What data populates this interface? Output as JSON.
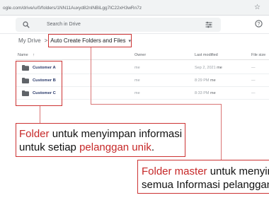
{
  "browser": {
    "url": "ogle.com/drive/u/0/folders/1NN11Auxyd82nlNBiLgg7lC22xH3wRn7z"
  },
  "search": {
    "placeholder": "Search in Drive"
  },
  "breadcrumb": {
    "root": "My Drive",
    "separator": ">",
    "current": "Auto Create Folders and Files"
  },
  "columns": {
    "name": "Name",
    "owner": "Owner",
    "modified": "Last modified",
    "size": "File size"
  },
  "files": [
    {
      "name": "Customer A",
      "owner": "me",
      "modified": "Sep 2, 2021",
      "modified_by": "me",
      "size": "—"
    },
    {
      "name": "Customer B",
      "owner": "me",
      "modified": "8:29 PM",
      "modified_by": "me",
      "size": "—"
    },
    {
      "name": "Customer C",
      "owner": "me",
      "modified": "8:33 PM",
      "modified_by": "me",
      "size": "—"
    }
  ],
  "annotations": {
    "note1": {
      "line1_a": "Folder",
      "line1_b": " untuk menyimpan informasi",
      "line2_a": "untuk setiap ",
      "line2_b": "pelanggan unik",
      "line2_c": "."
    },
    "note2": {
      "line1_a": "Folder master",
      "line1_b": " untuk menyimpan",
      "line2": "semua Informasi pelanggan"
    }
  },
  "colors": {
    "accent_red": "#c62828",
    "annotation_border": "#cc3333",
    "folder_icon": "#5f6368"
  },
  "icons": [
    "search-icon",
    "tune-icon",
    "help-icon",
    "folder-icon",
    "sort-arrow-icon",
    "dropdown-caret-icon",
    "star-icon"
  ]
}
